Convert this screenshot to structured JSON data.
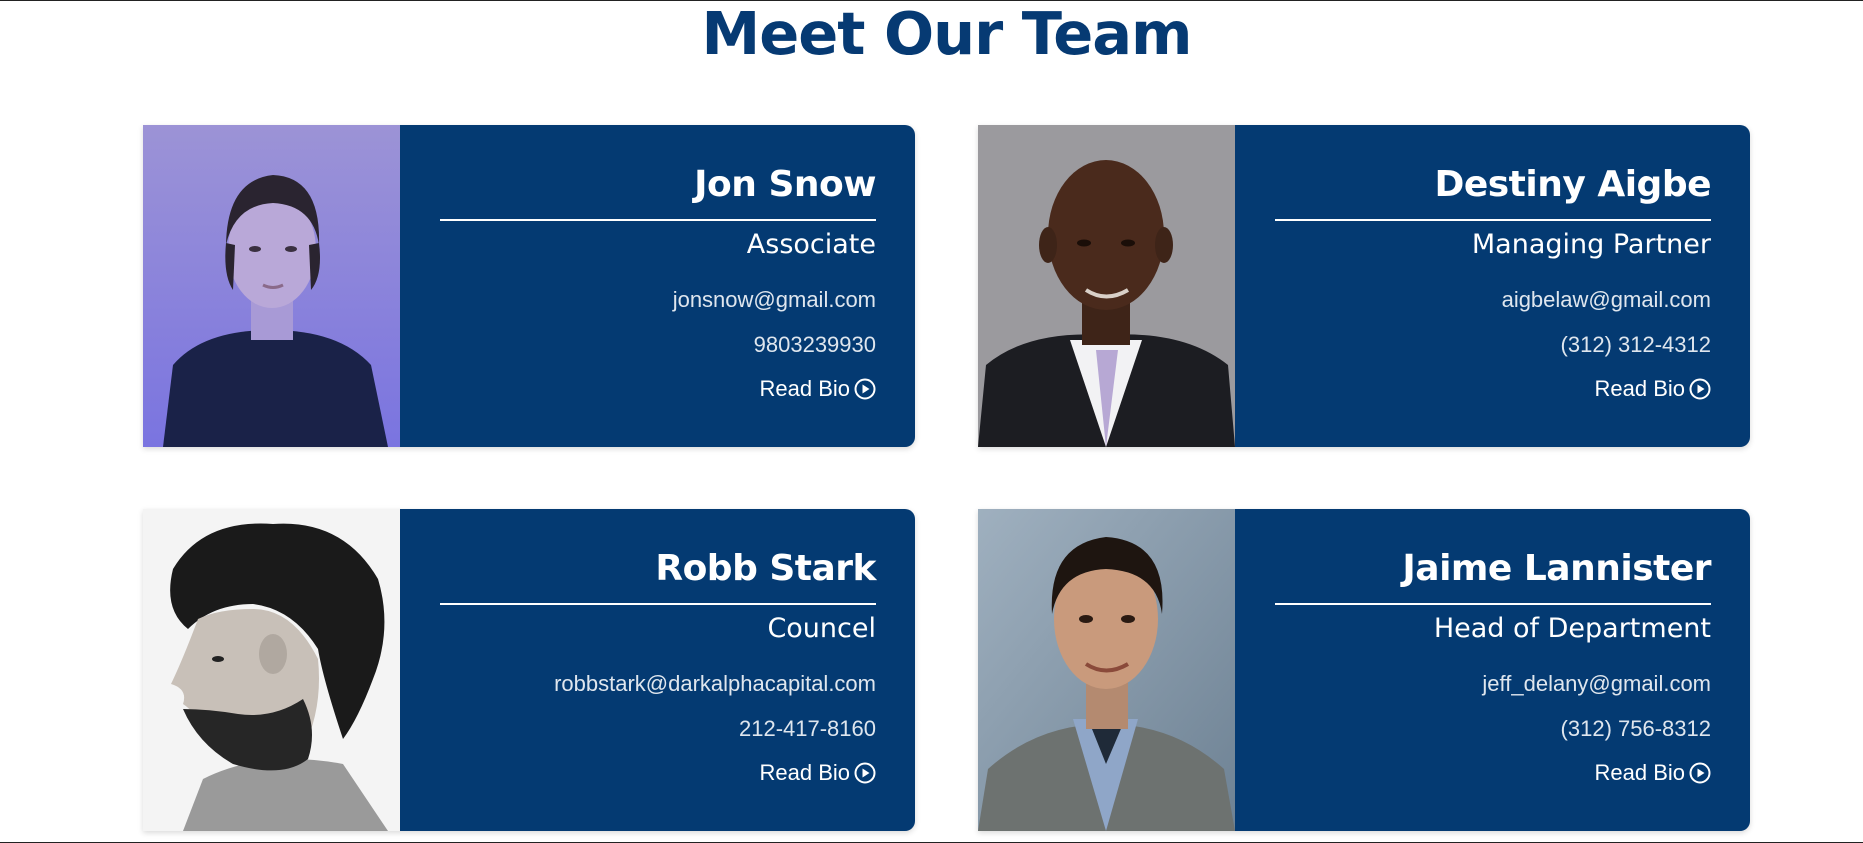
{
  "page": {
    "title": "Meet Our Team"
  },
  "colors": {
    "brand_navy": "#043a72",
    "title_color": "#063a73",
    "text_white": "#ffffff"
  },
  "team": [
    {
      "name": "Jon Snow",
      "role": "Associate",
      "email": "jonsnow@gmail.com",
      "phone": "9803239930",
      "read_bio": "Read Bio",
      "icon": "play-circle-icon"
    },
    {
      "name": "Destiny Aigbe",
      "role": "Managing Partner",
      "email": "aigbelaw@gmail.com",
      "phone": "(312) 312-4312",
      "read_bio": "Read Bio",
      "icon": "play-circle-icon"
    },
    {
      "name": "Robb Stark",
      "role": "Councel",
      "email": "robbstark@darkalphacapital.com",
      "phone": "212-417-8160",
      "read_bio": "Read Bio",
      "icon": "play-circle-icon"
    },
    {
      "name": "Jaime Lannister",
      "role": "Head of Department",
      "email": "jeff_delany@gmail.com",
      "phone": "(312) 756-8312",
      "read_bio": "Read Bio",
      "icon": "play-circle-icon"
    }
  ]
}
